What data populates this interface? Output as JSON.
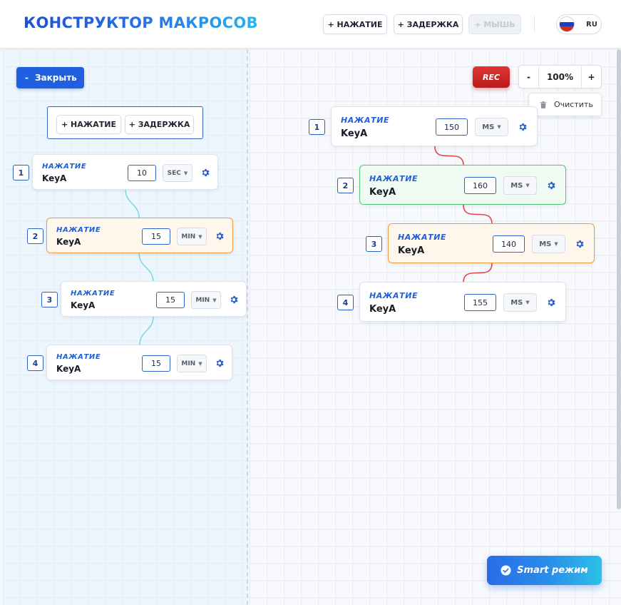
{
  "header": {
    "brand": "КОНСТРУКТОР МАКРОСОВ",
    "add_press_label": "+ НАЖАТИЕ",
    "add_delay_label": "+ ЗАДЕРЖКА",
    "add_mouse_label": "+ МЫШЬ",
    "language_code": "RU",
    "flag_colors": [
      "#ffffff",
      "#1c3fbf",
      "#d52b1e"
    ]
  },
  "left_panel": {
    "close_label": "Закрыть",
    "close_dash": "-",
    "add_press_label": "+ НАЖАТИЕ",
    "add_delay_label": "+ ЗАДЕРЖКА",
    "steps": [
      {
        "number": "1",
        "type": "НАЖАТИЕ",
        "key": "KeyA",
        "value": "10",
        "unit": "SEC",
        "state": "normal"
      },
      {
        "number": "2",
        "type": "НАЖАТИЕ",
        "key": "KeyA",
        "value": "15",
        "unit": "MIN",
        "state": "active"
      },
      {
        "number": "3",
        "type": "НАЖАТИЕ",
        "key": "KeyA",
        "value": "15",
        "unit": "MIN",
        "state": "normal"
      },
      {
        "number": "4",
        "type": "НАЖАТИЕ",
        "key": "KeyA",
        "value": "15",
        "unit": "MIN",
        "state": "normal"
      }
    ],
    "connector_color": "#7fd8e8"
  },
  "right_panel": {
    "rec_label": "REC",
    "zoom_minus": "-",
    "zoom_level": "100%",
    "zoom_plus": "+",
    "clear_label": "Очистить",
    "steps": [
      {
        "number": "1",
        "type": "НАЖАТИЕ",
        "key": "KeyA",
        "value": "150",
        "unit": "MS",
        "state": "normal"
      },
      {
        "number": "2",
        "type": "НАЖАТИЕ",
        "key": "KeyA",
        "value": "160",
        "unit": "MS",
        "state": "success"
      },
      {
        "number": "3",
        "type": "НАЖАТИЕ",
        "key": "KeyA",
        "value": "140",
        "unit": "MS",
        "state": "active"
      },
      {
        "number": "4",
        "type": "НАЖАТИЕ",
        "key": "KeyA",
        "value": "155",
        "unit": "MS",
        "state": "normal"
      }
    ],
    "connector_color": "#e04545"
  },
  "smart_mode_label": "Smart режим",
  "colors": {
    "accent": "#1f5fe0",
    "rec": "#c92727",
    "active_border": "#f59a3a",
    "success_border": "#55c37a"
  },
  "icons": {
    "gear": "gear-icon",
    "trash": "trash-icon",
    "check": "check-circle-icon",
    "caret": "chevron-down-icon"
  }
}
